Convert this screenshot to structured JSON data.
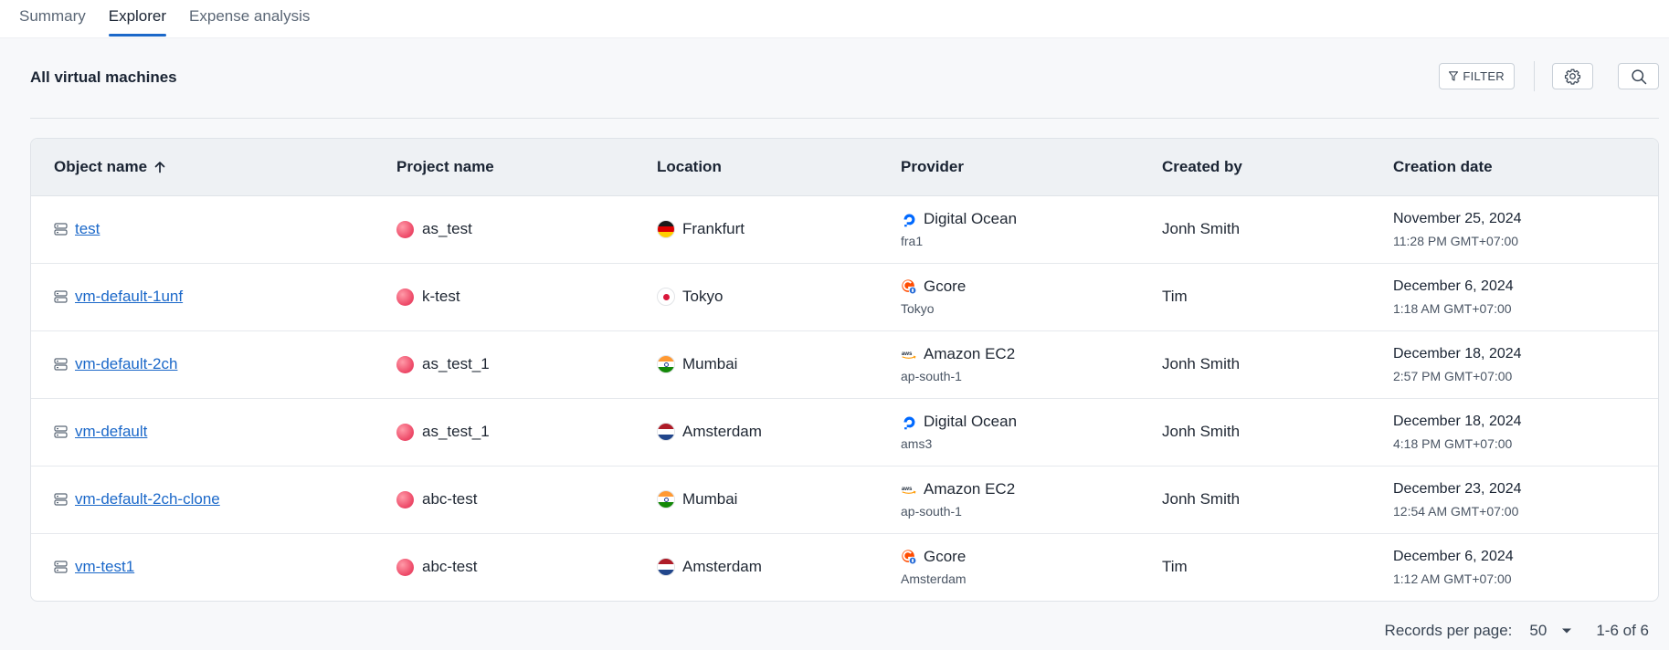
{
  "tabs": [
    {
      "label": "Summary",
      "active": false
    },
    {
      "label": "Explorer",
      "active": true
    },
    {
      "label": "Expense analysis",
      "active": false
    }
  ],
  "page": {
    "title": "All virtual machines",
    "filter_label": "FILTER"
  },
  "table": {
    "columns": [
      "Object name",
      "Project name",
      "Location",
      "Provider",
      "Created by",
      "Creation date"
    ],
    "sort_icon": "arrow-up-icon",
    "rows": [
      {
        "object": "test",
        "project": "as_test",
        "location": "Frankfurt",
        "flag": "de",
        "provider": "Digital Ocean",
        "provider_icon": "digital-ocean",
        "region": "fra1",
        "created_by": "Jonh Smith",
        "date": "November 25, 2024",
        "time": "11:28 PM GMT+07:00"
      },
      {
        "object": "vm-default-1unf",
        "project": "k-test",
        "location": "Tokyo",
        "flag": "jp",
        "provider": "Gcore",
        "provider_icon": "gcore",
        "region": "Tokyo",
        "created_by": "Tim",
        "date": "December 6, 2024",
        "time": "1:18 AM GMT+07:00"
      },
      {
        "object": "vm-default-2ch",
        "project": "as_test_1",
        "location": "Mumbai",
        "flag": "in",
        "provider": "Amazon EC2",
        "provider_icon": "aws",
        "region": "ap-south-1",
        "created_by": "Jonh Smith",
        "date": "December 18, 2024",
        "time": "2:57 PM GMT+07:00"
      },
      {
        "object": "vm-default",
        "project": "as_test_1",
        "location": "Amsterdam",
        "flag": "nl",
        "provider": "Digital Ocean",
        "provider_icon": "digital-ocean",
        "region": "ams3",
        "created_by": "Jonh Smith",
        "date": "December 18, 2024",
        "time": "4:18 PM GMT+07:00"
      },
      {
        "object": "vm-default-2ch-clone",
        "project": "abc-test",
        "location": "Mumbai",
        "flag": "in",
        "provider": "Amazon EC2",
        "provider_icon": "aws",
        "region": "ap-south-1",
        "created_by": "Jonh Smith",
        "date": "December 23, 2024",
        "time": "12:54 AM GMT+07:00"
      },
      {
        "object": "vm-test1",
        "project": "abc-test",
        "location": "Amsterdam",
        "flag": "nl",
        "provider": "Gcore",
        "provider_icon": "gcore",
        "region": "Amsterdam",
        "created_by": "Tim",
        "date": "December 6, 2024",
        "time": "1:12 AM GMT+07:00"
      }
    ]
  },
  "pagination": {
    "records_label": "Records per page:",
    "per_page": "50",
    "range": "1-6 of 6"
  },
  "colors": {
    "accent": "#1b68c9",
    "header_bg": "#eef1f4",
    "project_icon": "#ee4b69"
  }
}
